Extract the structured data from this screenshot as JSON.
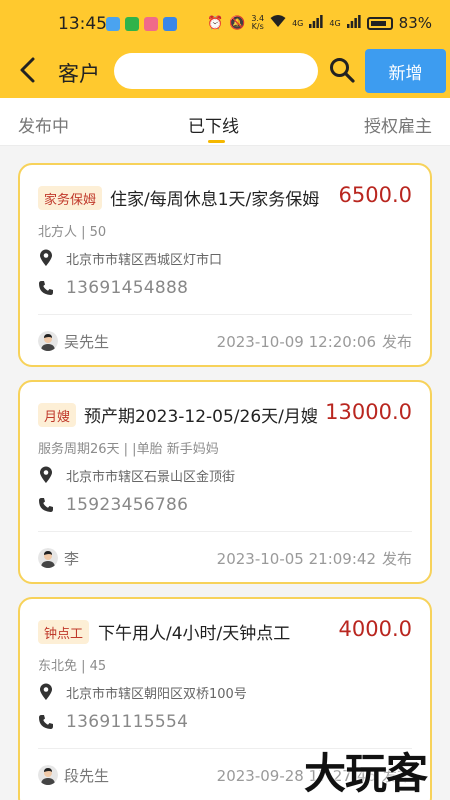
{
  "status_bar": {
    "time": "13:45",
    "net_speed_value": "3.4",
    "net_speed_unit": "K/s",
    "signal1": "4G",
    "signal2": "4G",
    "battery": "83%"
  },
  "header": {
    "title": "客户",
    "search_placeholder": "",
    "add_label": "新增"
  },
  "tabs": [
    {
      "label": "发布中",
      "active": false
    },
    {
      "label": "已下线",
      "active": true
    },
    {
      "label": "授权雇主",
      "active": false
    }
  ],
  "cards": [
    {
      "badge": "家务保姆",
      "title": "住家/每周休息1天/家务保姆",
      "price": "6500.0",
      "meta": "北方人 | 50",
      "address": "北京市市辖区西城区灯市口",
      "phone": "13691454888",
      "person": "吴先生",
      "posted_at": "2023-10-09 12:20:06",
      "posted_label": "发布"
    },
    {
      "badge": "月嫂",
      "title": "预产期2023-12-05/26天/月嫂",
      "price": "13000.0",
      "meta": "服务周期26天 | |单胎 新手妈妈",
      "address": "北京市市辖区石景山区金顶街",
      "phone": "15923456786",
      "person": "李",
      "posted_at": "2023-10-05 21:09:42",
      "posted_label": "发布"
    },
    {
      "badge": "钟点工",
      "title": "下午用人/4小时/天钟点工",
      "price": "4000.0",
      "meta": "东北免 | 45",
      "address": "北京市市辖区朝阳区双桥100号",
      "phone": "13691115554",
      "person": "段先生",
      "posted_at": "2023-09-28 17:27:46",
      "posted_label": "发布"
    }
  ],
  "watermark": "大玩客",
  "colors": {
    "header_bg": "#ffc92e",
    "add_button": "#3d9cf0",
    "price": "#b9261f",
    "card_border": "#f7d25a",
    "badge_bg": "#fdefd6",
    "badge_text": "#c0392b",
    "tab_indicator": "#f5b800"
  }
}
